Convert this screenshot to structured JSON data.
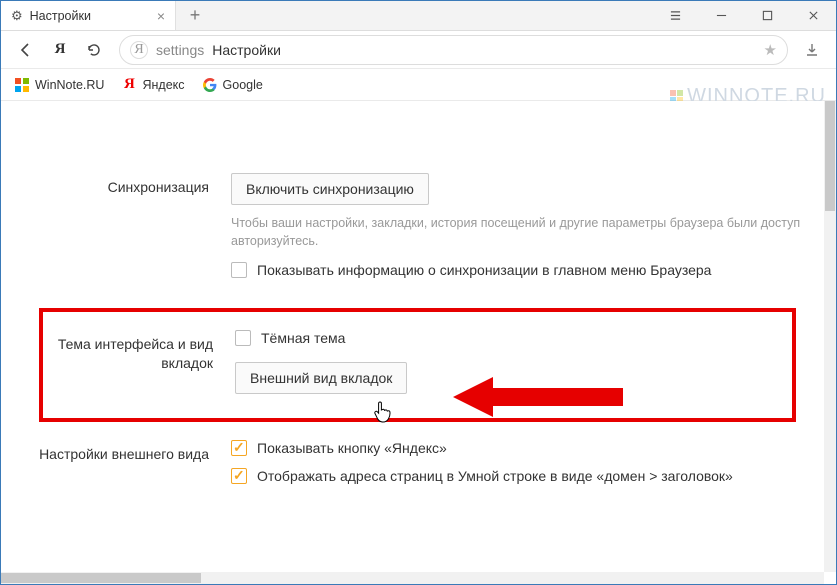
{
  "tab": {
    "title": "Настройки"
  },
  "address": {
    "prefix": "settings",
    "title": "Настройки"
  },
  "bookmarks": [
    {
      "label": "WinNote.RU",
      "icon": "winnote"
    },
    {
      "label": "Яндекс",
      "icon": "yandex"
    },
    {
      "label": "Google",
      "icon": "google"
    }
  ],
  "watermark": "WINNOTE.RU",
  "sections": {
    "sync": {
      "label": "Синхронизация",
      "button": "Включить синхронизацию",
      "hint": "Чтобы ваши настройки, закладки, история посещений и другие параметры браузера были доступ авторизуйтесь.",
      "checkbox": "Показывать информацию о синхронизации в главном меню Браузера"
    },
    "theme": {
      "label": "Тема интерфейса и вид вкладок",
      "checkbox": "Тёмная тема",
      "button": "Внешний вид вкладок"
    },
    "appearance": {
      "label": "Настройки внешнего вида",
      "check1": "Показывать кнопку «Яндекс»",
      "check2": "Отображать адреса страниц в Умной строке в виде «домен > заголовок»"
    }
  }
}
